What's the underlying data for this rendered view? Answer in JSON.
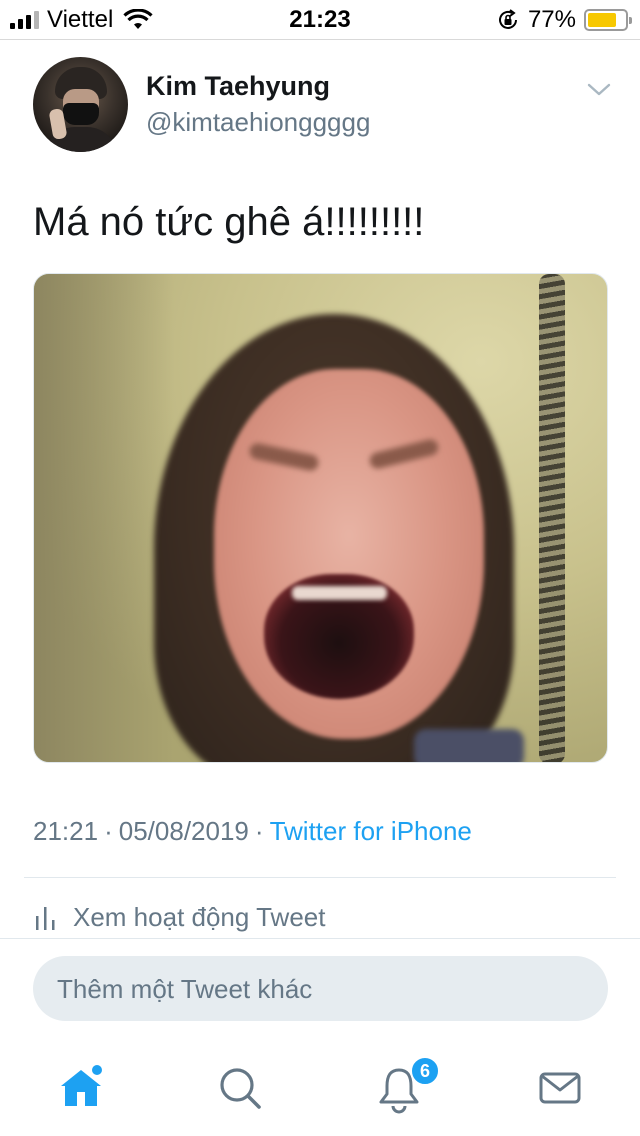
{
  "status_bar": {
    "carrier": "Viettel",
    "time": "21:23",
    "battery_percent": "77%",
    "battery_level": 0.77,
    "battery_color": "#f7c800",
    "signal_bars": 4,
    "signal_active": 3,
    "icons": [
      "signal-icon",
      "wifi-icon",
      "orientation-lock-icon",
      "battery-icon"
    ]
  },
  "tweet": {
    "author_name": "Kim Taehyung",
    "author_handle": "@kimtaehionggggg",
    "text": "Má nó tức ghê á!!!!!!!!!",
    "time": "21:21",
    "separator": "·",
    "date": "05/08/2019",
    "source": "Twitter for iPhone",
    "activity_label": "Xem hoạt động Tweet"
  },
  "reply": {
    "placeholder": "Thêm một Tweet khác"
  },
  "tab_bar": {
    "tabs": [
      {
        "icon": "home-icon",
        "active": true
      },
      {
        "icon": "search-icon",
        "active": false
      },
      {
        "icon": "notifications-icon",
        "active": false
      },
      {
        "icon": "messages-icon",
        "active": false
      }
    ],
    "notifications_badge": "6"
  },
  "colors": {
    "accent": "#1da1f2",
    "secondary_text": "#657786",
    "primary_text": "#14171a",
    "reply_box_bg": "#e6ecf0"
  }
}
